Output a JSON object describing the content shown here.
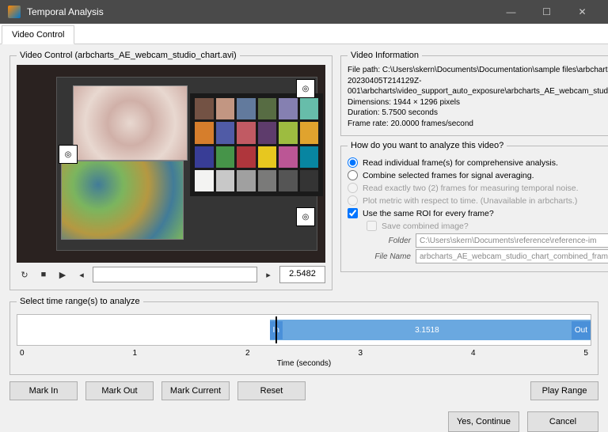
{
  "window": {
    "title": "Temporal Analysis"
  },
  "tabs": {
    "active": "Video Control"
  },
  "video_panel": {
    "legend": "Video Control (arbcharts_AE_webcam_studio_chart.avi)",
    "current_time": "2.5482"
  },
  "info": {
    "legend": "Video Information",
    "file_path": "File path: C:\\Users\\skern\\Documents\\Documentation\\sample files\\arbcharts-20230405T214129Z-001\\arbcharts\\video_support_auto_exposure\\arbcharts_AE_webcam_studio_chart.avi",
    "dimensions": "Dimensions: 1944 × 1296 pixels",
    "duration": "Duration: 5.7500 seconds",
    "frame_rate": "Frame rate: 20.0000 frames/second"
  },
  "analysis": {
    "legend": "How do you want to analyze this video?",
    "opt_individual": "Read individual frame(s) for comprehensive analysis.",
    "opt_combine": "Combine selected frames for signal averaging.",
    "opt_two": "Read exactly two (2) frames for measuring temporal noise.",
    "opt_metric": "Plot metric with respect to time. (Unavailable in arbcharts.)",
    "same_roi": "Use the same ROI for every frame?",
    "save_combined": "Save combined image?",
    "folder_lbl": "Folder",
    "folder_val": "C:\\Users\\skern\\Documents\\reference\\reference-im",
    "file_lbl": "File Name",
    "file_val": "arbcharts_AE_webcam_studio_chart_combined_frames"
  },
  "range": {
    "legend": "Select time range(s) to analyze",
    "in": "In",
    "out": "Out",
    "value": "3.1518",
    "axis_label": "Time (seconds)",
    "ticks": [
      "0",
      "1",
      "2",
      "3",
      "4",
      "5"
    ]
  },
  "buttons": {
    "mark_in": "Mark In",
    "mark_out": "Mark Out",
    "mark_current": "Mark Current",
    "reset": "Reset",
    "play_range": "Play Range",
    "yes": "Yes, Continue",
    "cancel": "Cancel"
  },
  "swatches": [
    "#735244",
    "#c29682",
    "#627a9d",
    "#576c43",
    "#8580b1",
    "#67bdaa",
    "#d67e2c",
    "#505ba6",
    "#c15a63",
    "#5e3c6c",
    "#9dbc40",
    "#e0a32e",
    "#383d96",
    "#469449",
    "#af363c",
    "#e7c71f",
    "#bb5695",
    "#0885a1",
    "#f3f3f2",
    "#c8c8c8",
    "#a0a0a0",
    "#7a7a79",
    "#555555",
    "#343434"
  ]
}
